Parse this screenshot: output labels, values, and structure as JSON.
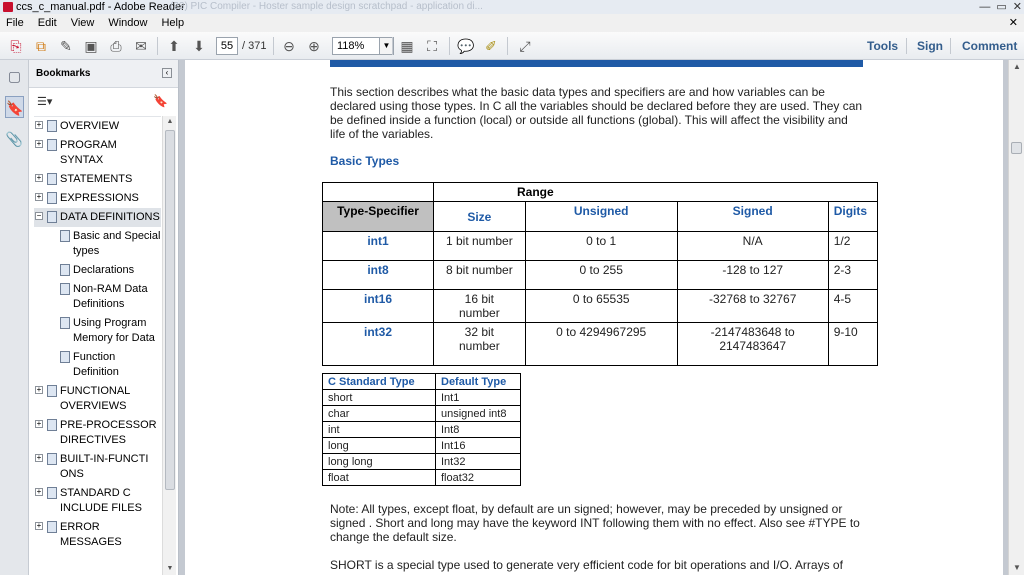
{
  "window": {
    "title": "ccs_c_manual.pdf - Adobe Reader",
    "background_tabs": "(23) PIC Compiler - Hoster    sample design    scratchpad - application di..."
  },
  "menu": [
    "File",
    "Edit",
    "View",
    "Window",
    "Help"
  ],
  "toolbar": {
    "page_current": "55",
    "page_total": "/ 371",
    "zoom": "118%",
    "right_links": [
      "Tools",
      "Sign",
      "Comment"
    ]
  },
  "bookmarks": {
    "title": "Bookmarks",
    "items": [
      {
        "label": "OVERVIEW",
        "level": 1,
        "expand": "+"
      },
      {
        "label": "PROGRAM SYNTAX",
        "level": 1,
        "expand": "+"
      },
      {
        "label": "STATEMENTS",
        "level": 1,
        "expand": "+"
      },
      {
        "label": "EXPRESSIONS",
        "level": 1,
        "expand": "+"
      },
      {
        "label": "DATA DEFINITIONS",
        "level": 1,
        "expand": "−",
        "selected": true
      },
      {
        "label": "Basic and Special types",
        "level": 2
      },
      {
        "label": "Declarations",
        "level": 2
      },
      {
        "label": "Non-RAM Data Definitions",
        "level": 2
      },
      {
        "label": "Using Program Memory for Data",
        "level": 2
      },
      {
        "label": "Function Definition",
        "level": 2
      },
      {
        "label": "FUNCTIONAL OVERVIEWS",
        "level": 1,
        "expand": "+"
      },
      {
        "label": "PRE-PROCESSOR DIRECTIVES",
        "level": 1,
        "expand": "+"
      },
      {
        "label": "BUILT-IN-FUNCTI ONS",
        "level": 1,
        "expand": "+"
      },
      {
        "label": "STANDARD C INCLUDE FILES",
        "level": 1,
        "expand": "+"
      },
      {
        "label": "ERROR MESSAGES",
        "level": 1,
        "expand": "+"
      }
    ]
  },
  "document": {
    "intro": "This section describes what the basic data types and specifiers are and how variables can be declared using those types. In C all the variables should be declared before they are used. They can be defined inside a function (local) or outside all functions (global). This will affect the visibility and life of the variables.",
    "basic_types_heading": "Basic Types",
    "basic_table": {
      "range_label": "Range",
      "headers": [
        "Type-Specifier",
        "Size",
        "Unsigned",
        "Signed",
        "Digits"
      ],
      "rows": [
        [
          "int1",
          "1 bit number",
          "0 to 1",
          "N/A",
          "1/2"
        ],
        [
          "int8",
          "8 bit number",
          "0 to 255",
          "-128 to 127",
          "2-3"
        ],
        [
          "int16",
          "16 bit number",
          "0 to 65535",
          "-32768 to 32767",
          "4-5"
        ],
        [
          "int32",
          "32 bit number",
          "0 to 4294967295",
          "-2147483648 to 2147483647",
          "9-10"
        ]
      ]
    },
    "std_table": {
      "headers": [
        "C Standard Type",
        "Default Type"
      ],
      "rows": [
        [
          "short",
          "Int1"
        ],
        [
          "char",
          "unsigned int8"
        ],
        [
          "int",
          "Int8"
        ],
        [
          "long",
          "Int16"
        ],
        [
          "long long",
          "Int32"
        ],
        [
          "float",
          "float32"
        ]
      ]
    },
    "note": "Note: All types, except float, by default are un signed; however, may be preceded by unsigned or signed . Short and long may have the keyword INT following them with no effect.  Also see #TYPE to change the default size.",
    "short_para": "SHORT is a special type used to generate very efficient code for bit operations and I/O.  Arrays of"
  }
}
